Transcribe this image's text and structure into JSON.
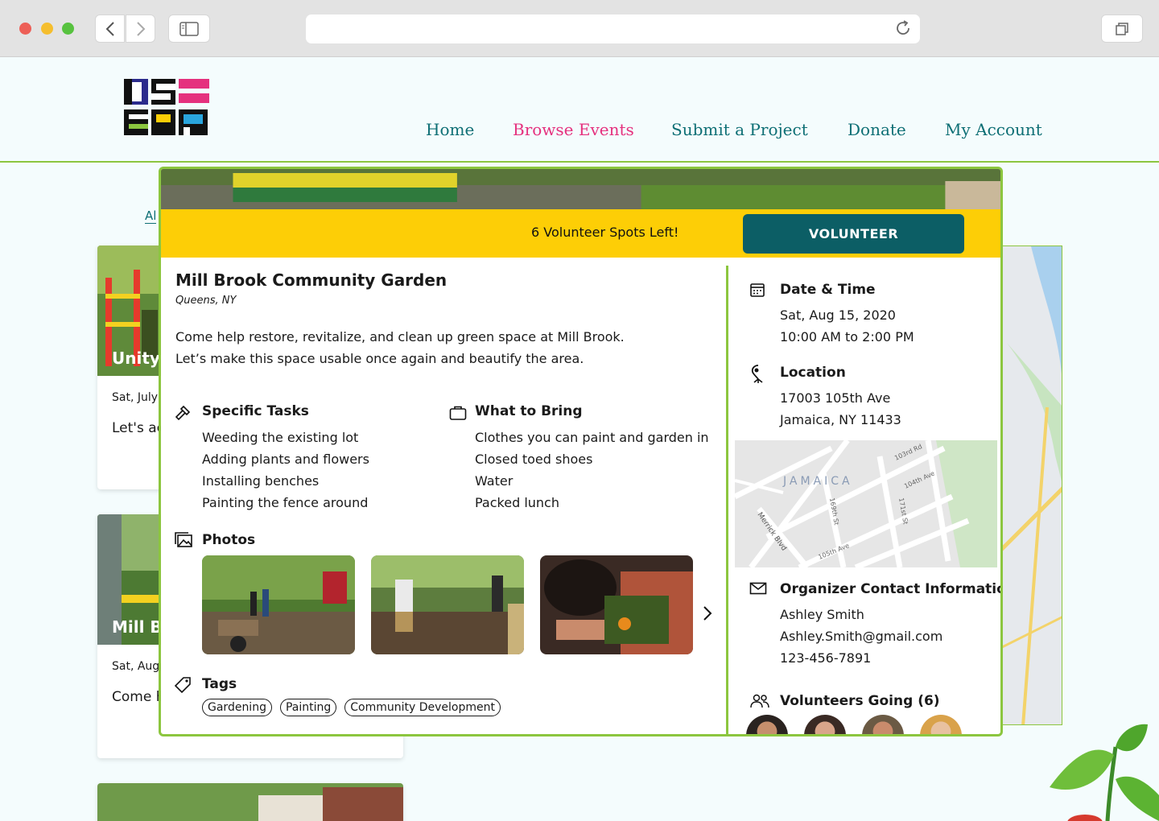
{
  "nav": {
    "home": "Home",
    "browse": "Browse Events",
    "submit": "Submit a Project",
    "donate": "Donate",
    "account": "My Account"
  },
  "background": {
    "filter_link": "Al",
    "cards": [
      {
        "title": "Unity",
        "date": "Sat, July",
        "text": "Let's ac to crea apartm"
      },
      {
        "title": "Mill Br",
        "date": "Sat, Aug",
        "text": "Come h up gree"
      }
    ]
  },
  "modal": {
    "spots": "6 Volunteer Spots Left!",
    "volunteer": "VOLUNTEER",
    "title": "Mill Brook Community Garden",
    "location_sub": "Queens, NY",
    "description_1": "Come help restore, revitalize, and clean up green space at Mill Brook.",
    "description_2": "Let’s make this space usable once again and beautify the area.",
    "tasks_heading": "Specific Tasks",
    "tasks": [
      "Weeding the existing lot",
      "Adding plants and flowers",
      "Installing benches",
      "Painting the fence around"
    ],
    "bring_heading": "What to Bring",
    "bring": [
      "Clothes you can paint and garden in",
      "Closed toed shoes",
      "Water",
      "Packed lunch"
    ],
    "photos_heading": "Photos",
    "tags_heading": "Tags",
    "tags": [
      "Gardening",
      "Painting",
      "Community Development"
    ],
    "date_heading": "Date & Time",
    "date": "Sat, Aug 15, 2020",
    "time": "10:00 AM to 2:00 PM",
    "location_heading": "Location",
    "address_1": "17003 105th Ave",
    "address_2": "Jamaica, NY 11433",
    "map": {
      "area": "JAMAICA",
      "streets": [
        "103rd Rd",
        "104th Ave",
        "169th St",
        "171st St",
        "Merrick Blvd",
        "105th Ave"
      ]
    },
    "organizer_heading": "Organizer Contact Information",
    "organizer_name": "Ashley Smith",
    "organizer_email": "Ashley.Smith@gmail.com",
    "organizer_phone": "123-456-7891",
    "volunteers_heading": "Volunteers Going (6)"
  },
  "colors": {
    "accent_green": "#8cc63f",
    "teal": "#0c5e65",
    "banner_yellow": "#fdce06",
    "active_pink": "#e5317e"
  }
}
